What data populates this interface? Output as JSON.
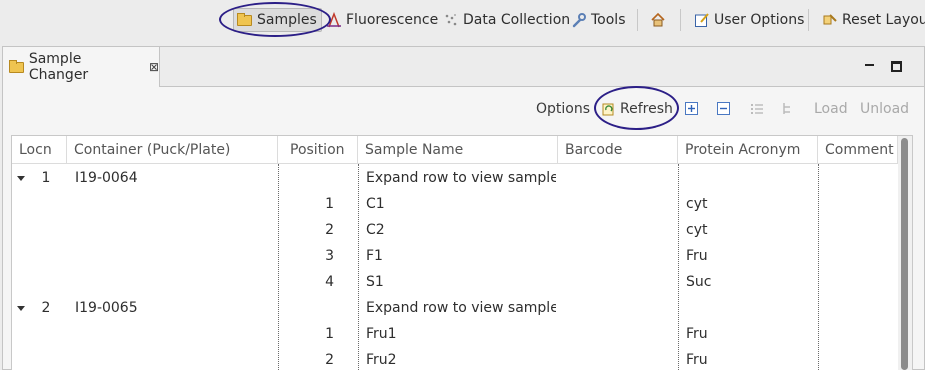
{
  "toolbar": {
    "samples": "Samples",
    "fluorescence": "Fluorescence",
    "data_collection": "Data Collection",
    "tools": "Tools",
    "user_options": "User Options",
    "reset_layout": "Reset Layout"
  },
  "panel": {
    "tab_title": "Sample Changer",
    "close_glyph": "⊠"
  },
  "view_toolbar": {
    "options": "Options",
    "refresh": "Refresh",
    "load": "Load",
    "unload": "Unload"
  },
  "table": {
    "columns": [
      "Locn",
      "Container (Puck/Plate)",
      "Position",
      "Sample Name",
      "Barcode",
      "Protein Acronym",
      "Comment"
    ],
    "rows": [
      {
        "locn": "1",
        "container": "I19-0064",
        "position": "",
        "sample": "Expand row to view samples",
        "barcode": "",
        "protein": "",
        "comment": "",
        "expander": true
      },
      {
        "locn": "",
        "container": "",
        "position": "1",
        "sample": "C1",
        "barcode": "",
        "protein": "cyt",
        "comment": "",
        "expander": false
      },
      {
        "locn": "",
        "container": "",
        "position": "2",
        "sample": "C2",
        "barcode": "",
        "protein": "cyt",
        "comment": "",
        "expander": false
      },
      {
        "locn": "",
        "container": "",
        "position": "3",
        "sample": "F1",
        "barcode": "",
        "protein": "Fru",
        "comment": "",
        "expander": false
      },
      {
        "locn": "",
        "container": "",
        "position": "4",
        "sample": "S1",
        "barcode": "",
        "protein": "Suc",
        "comment": "",
        "expander": false
      },
      {
        "locn": "2",
        "container": "I19-0065",
        "position": "",
        "sample": "Expand row to view samples",
        "barcode": "",
        "protein": "",
        "comment": "",
        "expander": true
      },
      {
        "locn": "",
        "container": "",
        "position": "1",
        "sample": "Fru1",
        "barcode": "",
        "protein": "Fru",
        "comment": "",
        "expander": false
      },
      {
        "locn": "",
        "container": "",
        "position": "2",
        "sample": "Fru2",
        "barcode": "",
        "protein": "Fru",
        "comment": "",
        "expander": false
      }
    ]
  },
  "colors": {
    "highlight_circle": "#2c1f87",
    "folder": "#efc450",
    "icon_blue": "#4a78c2"
  }
}
